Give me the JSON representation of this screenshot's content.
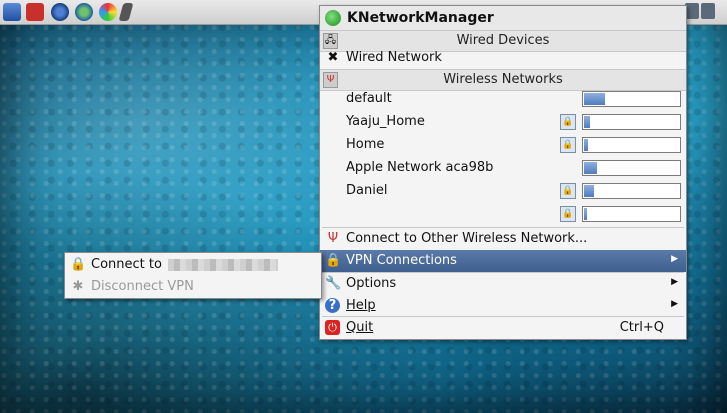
{
  "menu": {
    "title": "KNetworkManager",
    "sections": {
      "wired": "Wired Devices",
      "wireless": "Wireless Networks"
    },
    "wired_network": "Wired Network",
    "networks": [
      {
        "name": "default",
        "locked": false,
        "signal": 0.22
      },
      {
        "name": "Yaaju_Home",
        "locked": true,
        "signal": 0.06
      },
      {
        "name": "Home",
        "locked": true,
        "signal": 0.04
      },
      {
        "name": "Apple Network aca98b",
        "locked": false,
        "signal": 0.14
      },
      {
        "name": "Daniel",
        "locked": true,
        "signal": 0.1
      },
      {
        "name": "",
        "locked": true,
        "signal": 0.03
      }
    ],
    "connect_other": "Connect to Other Wireless Network...",
    "vpn": "VPN Connections",
    "options": "Options",
    "help": "Help",
    "quit": "Quit",
    "quit_shortcut": "Ctrl+Q"
  },
  "vpn_submenu": {
    "connect_to": "Connect to",
    "disconnect": "Disconnect VPN"
  }
}
